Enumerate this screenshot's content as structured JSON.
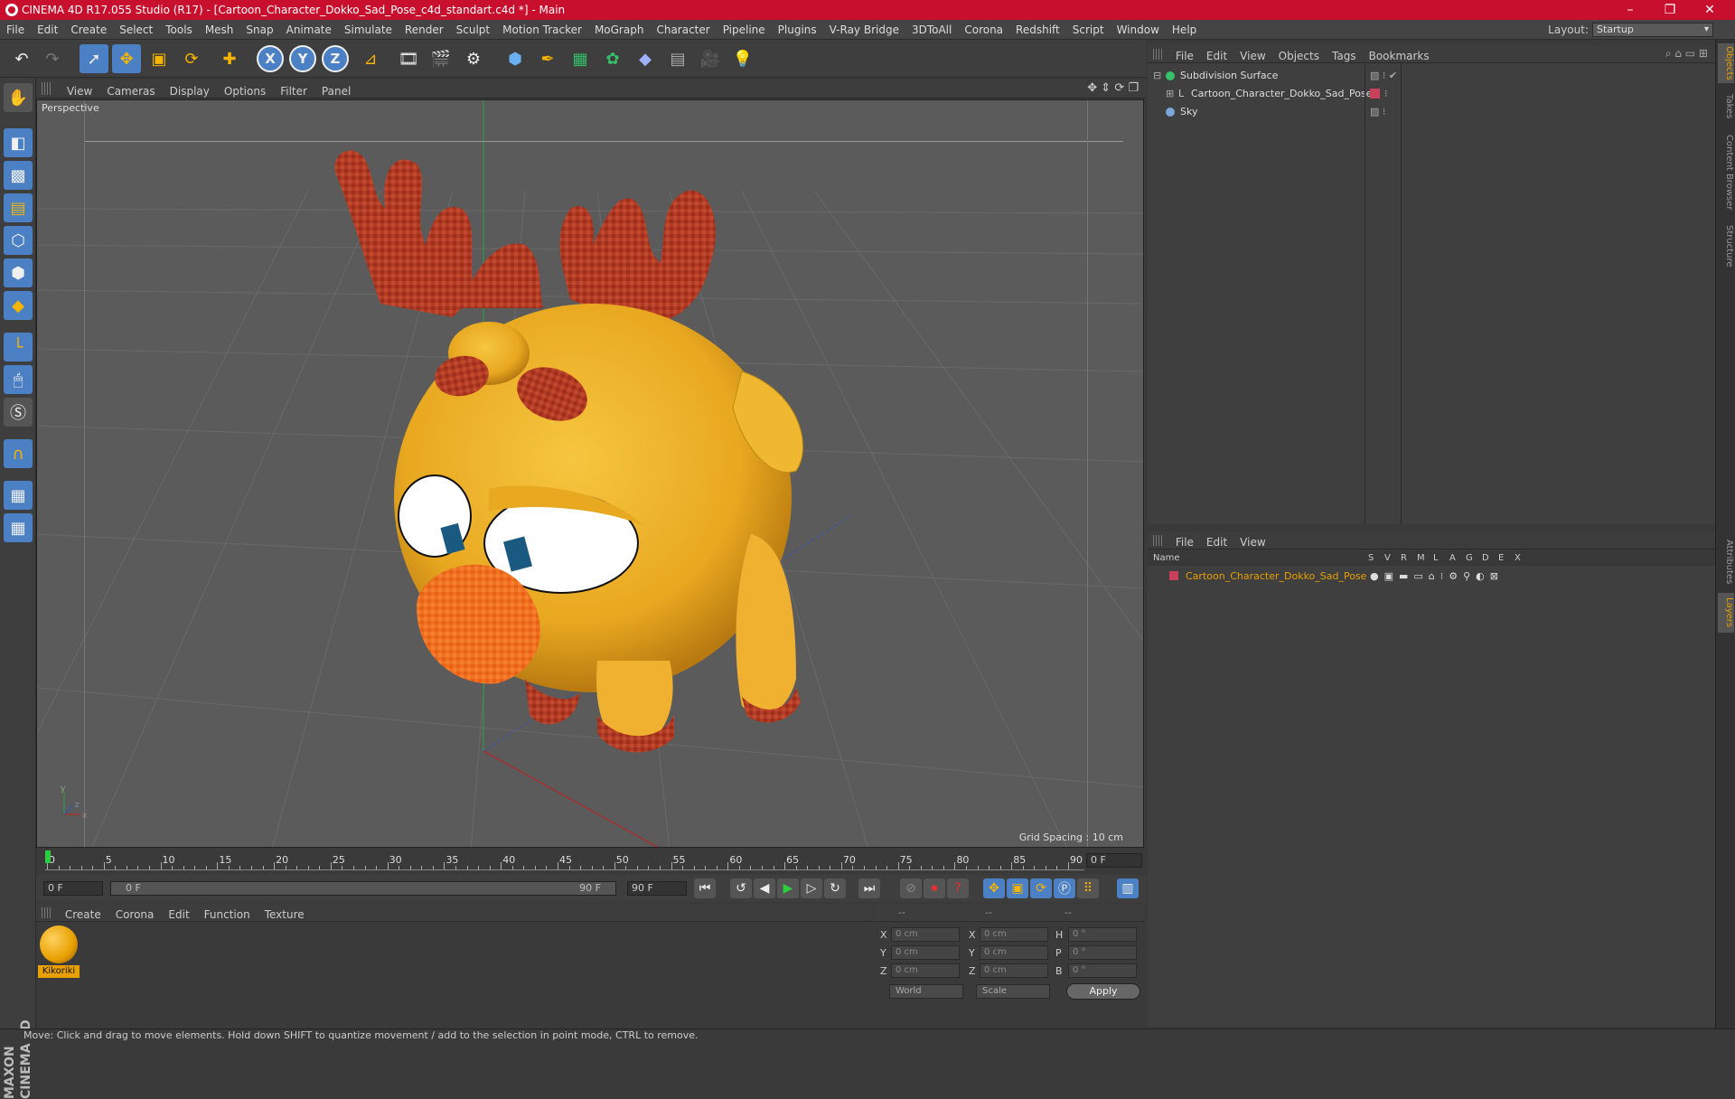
{
  "window": {
    "title": "CINEMA 4D R17.055 Studio (R17) - [Cartoon_Character_Dokko_Sad_Pose_c4d_standart.c4d *] - Main",
    "controls": [
      "–",
      "❐",
      "✕"
    ]
  },
  "menubar": {
    "items": [
      "File",
      "Edit",
      "Create",
      "Select",
      "Tools",
      "Mesh",
      "Snap",
      "Animate",
      "Simulate",
      "Render",
      "Sculpt",
      "Motion Tracker",
      "MoGraph",
      "Character",
      "Pipeline",
      "Plugins",
      "V-Ray Bridge",
      "3DToAll",
      "Corona",
      "Redshift",
      "Script",
      "Window",
      "Help"
    ],
    "layout_label": "Layout:",
    "layout_value": "Startup"
  },
  "toolbar": {
    "icons": [
      "undo-icon",
      "redo-icon",
      "live-select-icon",
      "move-icon",
      "scale-icon",
      "rotate-icon",
      "create-icon",
      "x-axis-icon",
      "y-axis-icon",
      "z-axis-icon",
      "world-coords-icon",
      "render-view-icon",
      "render-picture-viewer-icon",
      "edit-render-settings-icon",
      "cube-icon",
      "pen-icon",
      "subdivision-icon",
      "cloner-icon",
      "deformer-icon",
      "floor-icon",
      "camera-icon",
      "light-icon"
    ],
    "axis_labels": [
      "X",
      "Y",
      "Z"
    ]
  },
  "viewport": {
    "menu": [
      "View",
      "Cameras",
      "Display",
      "Options",
      "Filter",
      "Panel"
    ],
    "label": "Perspective",
    "grid_spacing": "Grid Spacing : 10 cm"
  },
  "timeline": {
    "ticks": [
      "0",
      "5",
      "10",
      "15",
      "20",
      "25",
      "30",
      "35",
      "40",
      "45",
      "50",
      "55",
      "60",
      "65",
      "70",
      "75",
      "80",
      "85",
      "90"
    ],
    "current_frame": "0 F",
    "start_field": "0 F",
    "range_start": "0 F",
    "range_end": "90 F",
    "end_field": "90 F"
  },
  "material_manager": {
    "menu": [
      "Create",
      "Corona",
      "Edit",
      "Function",
      "Texture"
    ],
    "materials": [
      {
        "name": "Kikoriki"
      }
    ]
  },
  "coordinates": {
    "header": [
      "--",
      "--",
      "--"
    ],
    "rows": [
      {
        "a": "X",
        "a_val": "0 cm",
        "b": "X",
        "b_val": "0 cm",
        "c": "H",
        "c_val": "0 °"
      },
      {
        "a": "Y",
        "a_val": "0 cm",
        "b": "Y",
        "b_val": "0 cm",
        "c": "P",
        "c_val": "0 °"
      },
      {
        "a": "Z",
        "a_val": "0 cm",
        "b": "Z",
        "b_val": "0 cm",
        "c": "B",
        "c_val": "0 °"
      }
    ],
    "mode": "World",
    "size_mode": "Scale",
    "apply": "Apply"
  },
  "object_manager": {
    "menu": [
      "File",
      "Edit",
      "View",
      "Objects",
      "Tags",
      "Bookmarks"
    ],
    "objects": [
      {
        "name": "Subdivision Surface",
        "color": "#35c06a"
      },
      {
        "name": "Cartoon_Character_Dokko_Sad_Pose",
        "color": "#cccccc"
      },
      {
        "name": "Sky",
        "color": "#7aa7d8"
      }
    ]
  },
  "layer_manager": {
    "menu": [
      "File",
      "Edit",
      "View"
    ],
    "columns": [
      "Name",
      "S",
      "V",
      "R",
      "M",
      "L",
      "A",
      "G",
      "D",
      "E",
      "X"
    ],
    "layers": [
      {
        "name": "Cartoon_Character_Dokko_Sad_Pose",
        "color": "#c8405a"
      }
    ]
  },
  "right_tabs": [
    "Objects",
    "Takes",
    "Content Browser",
    "Structure",
    "Attributes",
    "Layers"
  ],
  "status": "Move: Click and drag to move elements. Hold down SHIFT to quantize movement / add to the selection in point mode, CTRL to remove.",
  "brand": "MAXON CINEMA 4D",
  "colors": {
    "accent": "#4c80c4",
    "title_bar": "#c8102e",
    "material_highlight": "#e8a000"
  }
}
